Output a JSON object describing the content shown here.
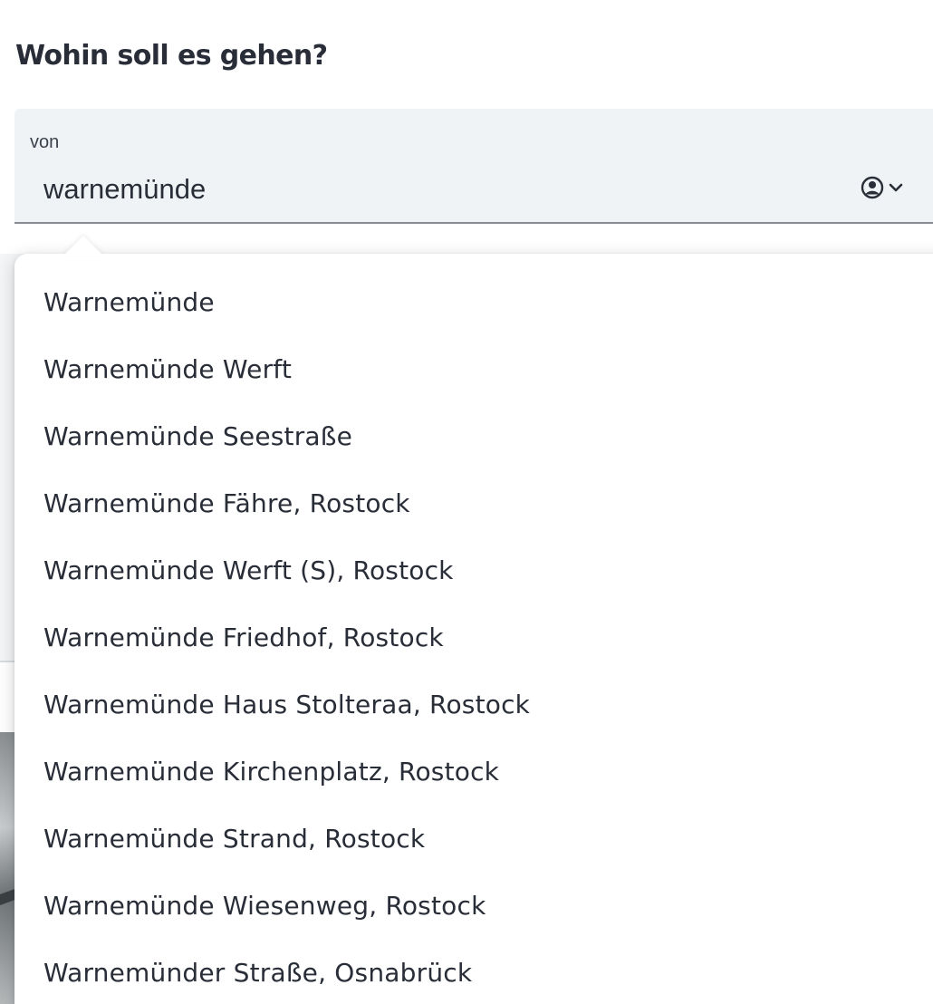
{
  "heading": "Wohin soll es gehen?",
  "from_field": {
    "label": "von",
    "value": "warnemünde"
  },
  "suggestions": [
    "Warnemünde",
    "Warnemünde Werft",
    "Warnemünde Seestraße",
    "Warnemünde Fähre, Rostock",
    "Warnemünde Werft (S), Rostock",
    "Warnemünde Friedhof, Rostock",
    "Warnemünde Haus Stolteraa, Rostock",
    "Warnemünde Kirchenplatz, Rostock",
    "Warnemünde Strand, Rostock",
    "Warnemünde Wiesenweg, Rostock",
    "Warnemünder Straße, Osnabrück"
  ],
  "icons": {
    "profile": "person-circle-icon",
    "expand": "chevron-down-icon"
  },
  "colors": {
    "text": "#282d37",
    "input_background": "#f0f3f5",
    "input_border": "#878c96",
    "dropdown_background": "#ffffff"
  }
}
